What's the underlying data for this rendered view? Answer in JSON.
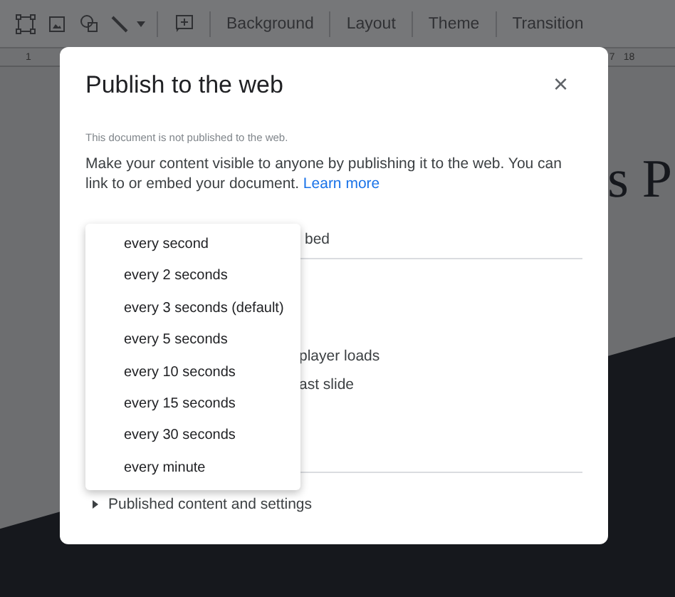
{
  "toolbar": {
    "buttons": [
      "Background",
      "Layout",
      "Theme",
      "Transition"
    ]
  },
  "ruler": {
    "labels": [
      "1",
      "7",
      "18"
    ]
  },
  "slide": {
    "title_fragments": [
      "s P"
    ]
  },
  "dialog": {
    "title": "Publish to the web",
    "close": "×",
    "notice": "This document is not published to the web.",
    "description": "Make your content visible to anyone by publishing it to the web. You can link to or embed your document.",
    "link": "Learn more",
    "tab_fragment": "bed",
    "option_fragments": [
      "player loads",
      "ast slide"
    ],
    "expander": {
      "label": "Published content and settings",
      "expanded": false
    }
  },
  "menu": {
    "items": [
      {
        "label": "every second"
      },
      {
        "label": "every 2 seconds"
      },
      {
        "label": "every 3 seconds (default)"
      },
      {
        "label": "every 5 seconds"
      },
      {
        "label": "every 10 seconds"
      },
      {
        "label": "every 15 seconds"
      },
      {
        "label": "every 30 seconds"
      },
      {
        "label": "every minute"
      }
    ]
  }
}
